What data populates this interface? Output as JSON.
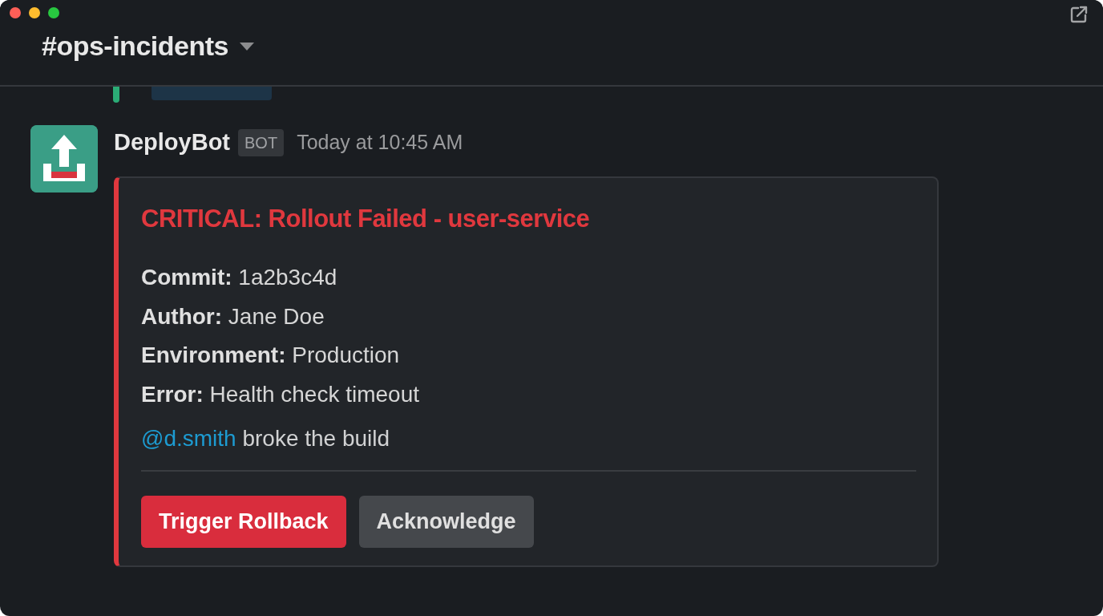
{
  "channel": {
    "title": "#ops-incidents"
  },
  "message": {
    "author": "DeployBot",
    "badge": "BOT",
    "time": "Today at 10:45 AM",
    "attachment": {
      "title": "CRITICAL: Rollout Failed - user-service",
      "fields": [
        {
          "label": "Commit:",
          "value": "1a2b3c4d"
        },
        {
          "label": "Author:",
          "value": "Jane Doe"
        },
        {
          "label": "Environment:",
          "value": "Production"
        },
        {
          "label": "Error:",
          "value": "Health check timeout"
        }
      ],
      "mention": "@d.smith",
      "text": "broke the build",
      "actions": [
        {
          "label": "Trigger Rollback",
          "kind": "danger"
        },
        {
          "label": "Acknowledge",
          "kind": "secondary"
        }
      ]
    }
  }
}
